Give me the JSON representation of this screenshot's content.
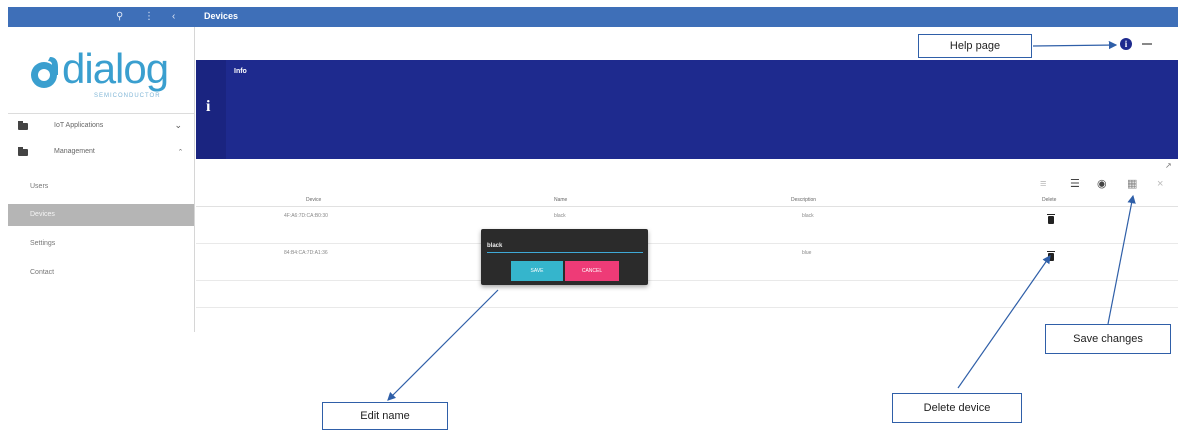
{
  "topbar": {
    "title": "Devices",
    "icons": [
      "search-icon",
      "more-vertical-icon",
      "chevron-left-icon"
    ],
    "color": "#3e6fb8"
  },
  "logo": {
    "word": "dialog",
    "subtitle": "SEMICONDUCTOR"
  },
  "sidebar": {
    "groups": [
      {
        "label": "IoT Applications",
        "icon": "folder-icon",
        "chevron": "down"
      },
      {
        "label": "Management",
        "icon": "folder-icon",
        "chevron": "up"
      }
    ],
    "items": [
      {
        "label": "Users"
      },
      {
        "label": "Devices",
        "active": true
      },
      {
        "label": "Settings"
      },
      {
        "label": "Contact"
      }
    ]
  },
  "banner": {
    "title": "Info",
    "icon": "info-icon",
    "color": "#1e2a8e"
  },
  "table": {
    "headers": [
      "Device",
      "Name",
      "Description",
      "Delete"
    ],
    "rows": [
      {
        "device": "4F:A6:7D:CA:B0:30",
        "name": "black",
        "description": "black"
      },
      {
        "device": "84:B4:CA:7D:A1:36",
        "name": "",
        "description": "blue"
      }
    ]
  },
  "popup": {
    "value": "black",
    "save_label": "SAVE",
    "cancel_label": "CANCEL"
  },
  "callouts": {
    "help": "Help page",
    "edit": "Edit name",
    "delete": "Delete device",
    "save": "Save changes"
  },
  "toolbar_icons": [
    "filter-icon",
    "list-icon",
    "eye-icon",
    "save-icon",
    "close-icon"
  ],
  "colors": {
    "accent": "#2f5fa8",
    "save_button": "#35b5cc",
    "cancel_button": "#ee3b77"
  }
}
